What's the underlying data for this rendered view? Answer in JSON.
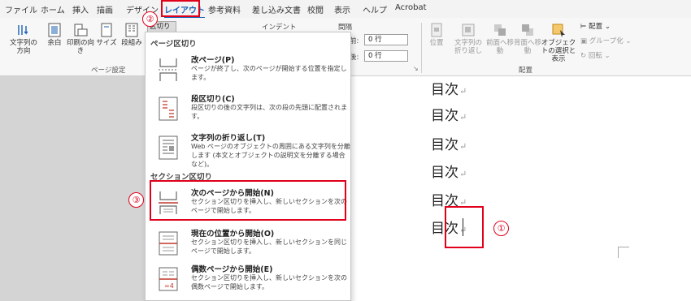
{
  "tabs": [
    "ファイル",
    "ホーム",
    "挿入",
    "描画",
    "デザイン",
    "レイアウト",
    "参考資料",
    "差し込み文書",
    "校閲",
    "表示",
    "ヘルプ",
    "Acrobat"
  ],
  "active_tab": "レイアウト",
  "ribbon": {
    "text_direction": "文字列の方向",
    "margins": "余白",
    "orientation": "印刷の向き",
    "size": "サイズ",
    "columns": "段組み",
    "breaks": "区切り",
    "page_setup_group": "ページ設定",
    "indent_label": "インデント",
    "spacing_label": "間隔",
    "before_label": "前:",
    "before_value": "0 行",
    "after_label": "後:",
    "after_value": "0 行",
    "position": "位置",
    "wrap_text": "文字列の折り返し",
    "bring_forward": "前面へ移動",
    "send_backward": "背面へ移動",
    "selection_pane": "オブジェクトの選択と表示",
    "align": "配置",
    "group": "グループ化",
    "rotate": "回転",
    "arrange_group": "配置"
  },
  "menu": {
    "page_breaks_header": "ページ区切り",
    "section_breaks_header": "セクション区切り",
    "items": [
      {
        "title": "改ページ(P)",
        "desc": "ページが終了し、次のページが開始する位置を指定します。"
      },
      {
        "title": "段区切り(C)",
        "desc": "段区切りの後の文字列は、次の段の先頭に配置されます。"
      },
      {
        "title": "文字列の折り返し(T)",
        "desc": "Web ページのオブジェクトの周囲にある文字列を分離します (本文とオブジェクトの説明文を分離する場合など)。"
      },
      {
        "title": "次のページから開始(N)",
        "desc": "セクション区切りを挿入し、新しいセクションを次のページで開始します。"
      },
      {
        "title": "現在の位置から開始(O)",
        "desc": "セクション区切りを挿入し、新しいセクションを同じページで開始します。"
      },
      {
        "title": "偶数ページから開始(E)",
        "desc": "セクション区切りを挿入し、新しいセクションを次の偶数ページで開始します。"
      }
    ]
  },
  "document": {
    "lines": [
      "目次",
      "目次",
      "目次",
      "目次",
      "目次",
      "目次"
    ],
    "return_mark": "↵"
  },
  "callouts": [
    "①",
    "②",
    "③"
  ],
  "colors": {
    "highlight": "#e0001b",
    "accent": "#1a5fb4"
  }
}
